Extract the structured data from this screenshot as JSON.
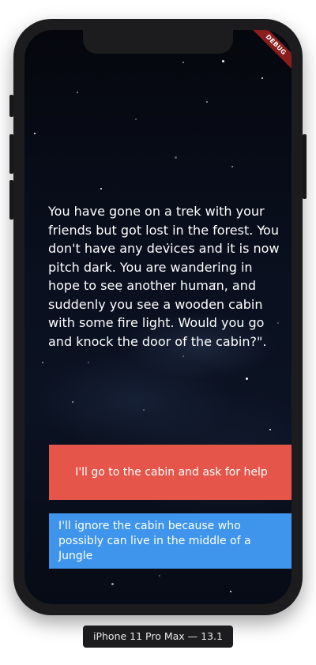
{
  "debug_banner": "DEBUG",
  "story": {
    "text": "You have gone on a trek with your friends but got lost in the forest. You don't have any devices and it is now pitch dark. You are wandering in hope to see another human, and suddenly you see a wooden cabin with some fire light. Would you go and knock the door of the cabin?\"."
  },
  "choices": [
    {
      "label": "I'll go to the cabin and ask for help",
      "color": "#e6554a"
    },
    {
      "label": "I'll ignore the cabin because who possibly can live in the middle of a Jungle",
      "color": "#3f95ec"
    }
  ],
  "device": {
    "label": "iPhone 11 Pro Max — 13.1"
  }
}
